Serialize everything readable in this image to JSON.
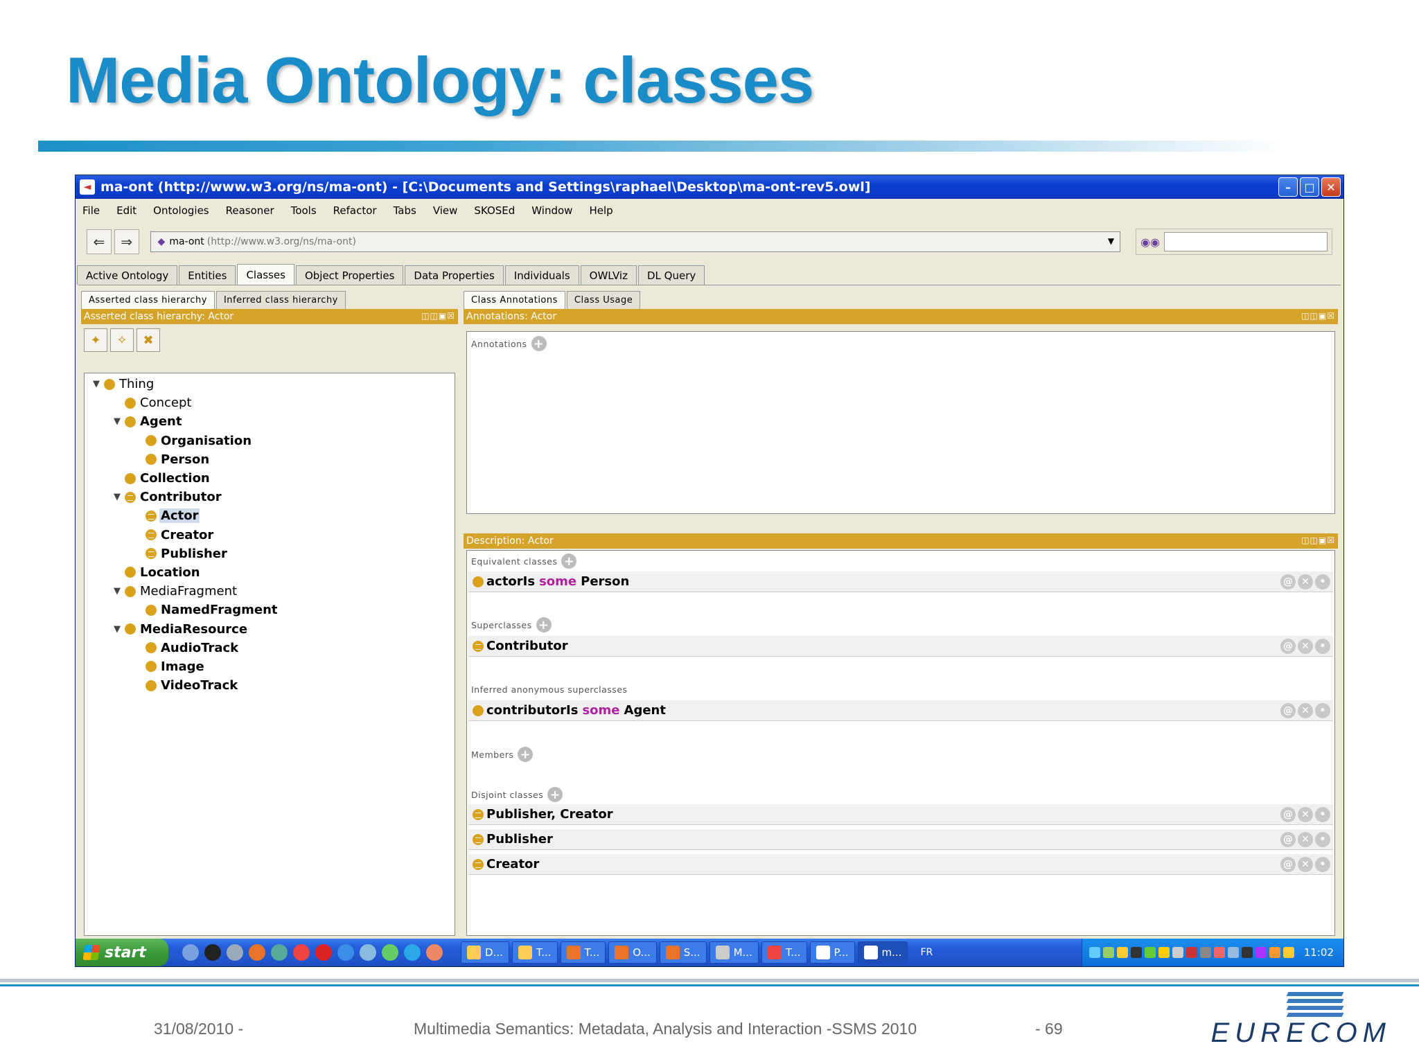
{
  "slide": {
    "title": "Media Ontology: classes",
    "footer_date": "31/08/2010 -",
    "footer_text": "Multimedia Semantics: Metadata, Analysis and Interaction -SSMS 2010",
    "footer_page": "- 69",
    "logo_text": "EURECOM"
  },
  "window": {
    "title": "ma-ont (http://www.w3.org/ns/ma-ont) - [C:\\Documents and Settings\\raphael\\Desktop\\ma-ont-rev5.owl]",
    "menu": [
      "File",
      "Edit",
      "Ontologies",
      "Reasoner",
      "Tools",
      "Refactor",
      "Tabs",
      "View",
      "SKOSEd",
      "Window",
      "Help"
    ],
    "ontology_name": "ma-ont",
    "ontology_iri": "(http://www.w3.org/ns/ma-ont)",
    "tabs": [
      "Active Ontology",
      "Entities",
      "Classes",
      "Object Properties",
      "Data Properties",
      "Individuals",
      "OWLViz",
      "DL Query"
    ],
    "active_tab": "Classes"
  },
  "left": {
    "subtabs": [
      "Asserted class hierarchy",
      "Inferred class hierarchy"
    ],
    "header": "Asserted class hierarchy: Actor",
    "tree": [
      {
        "label": "Thing",
        "level": 0,
        "toggle": true,
        "bold": false,
        "eq": false
      },
      {
        "label": "Concept",
        "level": 1,
        "toggle": false,
        "bold": false,
        "eq": false
      },
      {
        "label": "Agent",
        "level": 1,
        "toggle": true,
        "bold": true,
        "eq": false
      },
      {
        "label": "Organisation",
        "level": 2,
        "toggle": false,
        "bold": true,
        "eq": false
      },
      {
        "label": "Person",
        "level": 2,
        "toggle": false,
        "bold": true,
        "eq": false
      },
      {
        "label": "Collection",
        "level": 1,
        "toggle": false,
        "bold": true,
        "eq": false
      },
      {
        "label": "Contributor",
        "level": 1,
        "toggle": true,
        "bold": true,
        "eq": true
      },
      {
        "label": "Actor",
        "level": 2,
        "toggle": false,
        "bold": true,
        "eq": true,
        "selected": true
      },
      {
        "label": "Creator",
        "level": 2,
        "toggle": false,
        "bold": true,
        "eq": true
      },
      {
        "label": "Publisher",
        "level": 2,
        "toggle": false,
        "bold": true,
        "eq": true
      },
      {
        "label": "Location",
        "level": 1,
        "toggle": false,
        "bold": true,
        "eq": false
      },
      {
        "label": "MediaFragment",
        "level": 1,
        "toggle": true,
        "bold": false,
        "eq": false
      },
      {
        "label": "NamedFragment",
        "level": 2,
        "toggle": false,
        "bold": true,
        "eq": false
      },
      {
        "label": "MediaResource",
        "level": 1,
        "toggle": true,
        "bold": true,
        "eq": false
      },
      {
        "label": "AudioTrack",
        "level": 2,
        "toggle": false,
        "bold": true,
        "eq": false
      },
      {
        "label": "Image",
        "level": 2,
        "toggle": false,
        "bold": true,
        "eq": false
      },
      {
        "label": "VideoTrack",
        "level": 2,
        "toggle": false,
        "bold": true,
        "eq": false
      }
    ]
  },
  "right": {
    "subtabs": [
      "Class Annotations",
      "Class Usage"
    ],
    "annotations_header": "Annotations: Actor",
    "annotations_label": "Annotations",
    "description_header": "Description: Actor",
    "equivalent_label": "Equivalent classes",
    "equivalent": {
      "pre": "actorIs",
      "kw": "some",
      "post": "Person"
    },
    "superclasses_label": "Superclasses",
    "superclass": "Contributor",
    "inferred_label": "Inferred anonymous superclasses",
    "inferred": {
      "pre": "contributorIs",
      "kw": "some",
      "post": "Agent"
    },
    "members_label": "Members",
    "disjoint_label": "Disjoint classes",
    "disjoint": [
      "Publisher, Creator",
      "Publisher",
      "Creator"
    ]
  },
  "taskbar": {
    "start": "start",
    "items": [
      "D...",
      "T...",
      "T...",
      "O...",
      "S...",
      "M...",
      "T...",
      "P...",
      "m..."
    ],
    "lang": "FR",
    "clock": "11:02"
  }
}
